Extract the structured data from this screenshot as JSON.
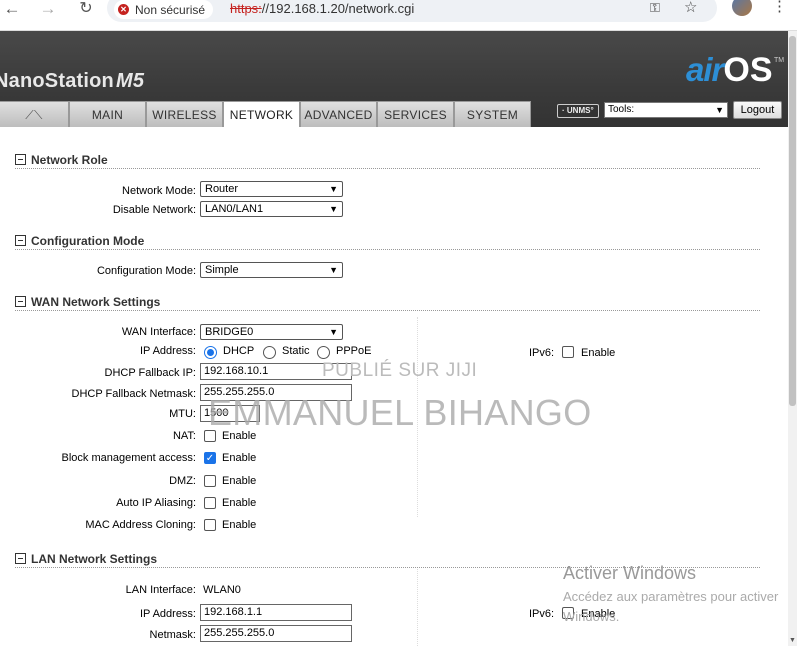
{
  "browser": {
    "security_label": "Non sécurisé",
    "url_scheme": "https:",
    "url_rest": "//192.168.1.20/network.cgi"
  },
  "header": {
    "product_name": "NanoStation",
    "product_model": "M5",
    "logo_air": "air",
    "logo_os": "OS",
    "logo_tm": "TM",
    "unms_label": "· UNMS°",
    "tools_value": "Tools:",
    "logout_label": "Logout"
  },
  "tabs": [
    {
      "label": "MAIN"
    },
    {
      "label": "WIRELESS"
    },
    {
      "label": "NETWORK"
    },
    {
      "label": "ADVANCED"
    },
    {
      "label": "SERVICES"
    },
    {
      "label": "SYSTEM"
    }
  ],
  "active_tab": "NETWORK",
  "network_role": {
    "title": "Network Role",
    "network_mode_label": "Network Mode:",
    "network_mode_value": "Router",
    "disable_network_label": "Disable Network:",
    "disable_network_value": "LAN0/LAN1"
  },
  "configuration_mode": {
    "title": "Configuration Mode",
    "label": "Configuration Mode:",
    "value": "Simple"
  },
  "wan": {
    "title": "WAN Network Settings",
    "interface_label": "WAN Interface:",
    "interface_value": "BRIDGE0",
    "ip_label": "IP Address:",
    "ip_options": [
      "DHCP",
      "Static",
      "PPPoE"
    ],
    "ip_selected": "DHCP",
    "ipv6_label": "IPv6:",
    "ipv6_enable": "Enable",
    "dhcp_fallback_ip_label": "DHCP Fallback IP:",
    "dhcp_fallback_ip_value": "192.168.10.1",
    "dhcp_fallback_netmask_label": "DHCP Fallback Netmask:",
    "dhcp_fallback_netmask_value": "255.255.255.0",
    "mtu_label": "MTU:",
    "mtu_value": "1500",
    "nat_label": "NAT:",
    "nat_enable": "Enable",
    "block_mgmt_label": "Block management access:",
    "block_mgmt_enable": "Enable",
    "dmz_label": "DMZ:",
    "dmz_enable": "Enable",
    "auto_ip_label": "Auto IP Aliasing:",
    "auto_ip_enable": "Enable",
    "mac_clone_label": "MAC Address Cloning:",
    "mac_clone_enable": "Enable"
  },
  "lan": {
    "title": "LAN Network Settings",
    "interface_label": "LAN Interface:",
    "interface_value": "WLAN0",
    "ip_label": "IP Address:",
    "ip_value": "192.168.1.1",
    "netmask_label": "Netmask:",
    "netmask_value": "255.255.255.0",
    "ipv6_label": "IPv6:",
    "ipv6_enable": "Enable"
  },
  "overlay": {
    "watermark_line1": "PUBLIÉ SUR JIJI",
    "watermark_line2": "EMMANUEL BIHANGO",
    "windows_title": "Activer Windows",
    "windows_sub1": "Accédez aux paramètres pour activer",
    "windows_sub2": "Windows."
  }
}
